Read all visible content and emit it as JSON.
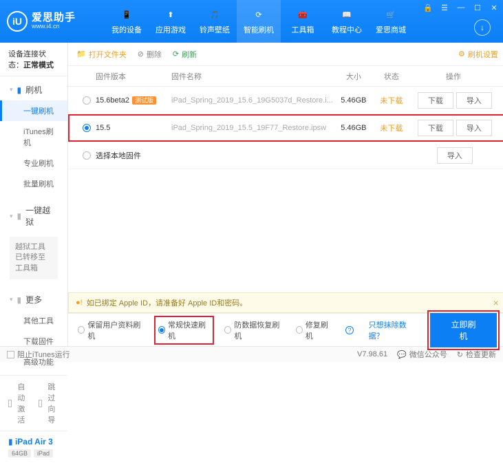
{
  "brand": {
    "name": "爱思助手",
    "url": "www.i4.cn",
    "logo_letter": "iU"
  },
  "nav": [
    {
      "label": "我的设备"
    },
    {
      "label": "应用游戏"
    },
    {
      "label": "铃声壁纸"
    },
    {
      "label": "智能刷机"
    },
    {
      "label": "工具箱"
    },
    {
      "label": "教程中心"
    },
    {
      "label": "爱思商城"
    }
  ],
  "nav_active": 3,
  "device_status": {
    "label": "设备连接状态：",
    "value": "正常模式"
  },
  "sidebar": {
    "groups": [
      {
        "head": "刷机",
        "icon": "phone-icon",
        "items": [
          "一键刷机",
          "iTunes刷机",
          "专业刷机",
          "批量刷机"
        ],
        "active": 0
      },
      {
        "head": "一键越狱",
        "icon": "lock-icon",
        "note": "越狱工具已转移至工具箱"
      },
      {
        "head": "更多",
        "icon": "menu-icon",
        "items": [
          "其他工具",
          "下载固件",
          "高级功能"
        ]
      }
    ],
    "auto_activate": "自动激活",
    "skip_guide": "跳过向导",
    "device": {
      "name": "iPad Air 3",
      "chips": [
        "64GB",
        "iPad"
      ]
    }
  },
  "toolbar": {
    "open_folder": "打开文件夹",
    "delete": "删除",
    "refresh": "刷新",
    "settings": "刷机设置"
  },
  "columns": {
    "ver": "固件版本",
    "name": "固件名称",
    "size": "大小",
    "status": "状态",
    "ops": "操作"
  },
  "rows": [
    {
      "selected": false,
      "ver": "15.6beta2",
      "beta": true,
      "beta_tag": "测试版",
      "name": "iPad_Spring_2019_15.6_19G5037d_Restore.i...",
      "size": "5.46GB",
      "status": "未下载",
      "ops": [
        "下载",
        "导入"
      ]
    },
    {
      "selected": true,
      "ver": "15.5",
      "beta": false,
      "name": "iPad_Spring_2019_15.5_19F77_Restore.ipsw",
      "size": "5.46GB",
      "status": "未下载",
      "ops": [
        "下载",
        "导入"
      ]
    }
  ],
  "local_row": {
    "label": "选择本地固件",
    "op": "导入"
  },
  "warning": "如已绑定 Apple ID，请准备好 Apple ID和密码。",
  "footer": {
    "opts": [
      "保留用户资料刷机",
      "常规快速刷机",
      "防数据恢复刷机",
      "修复刷机"
    ],
    "selected": 1,
    "exclude_link": "只想抹除数据？",
    "flash": "立即刷机"
  },
  "statusbar": {
    "block_itunes": "阻止iTunes运行",
    "version": "V7.98.61",
    "wechat": "微信公众号",
    "update": "检查更新"
  }
}
